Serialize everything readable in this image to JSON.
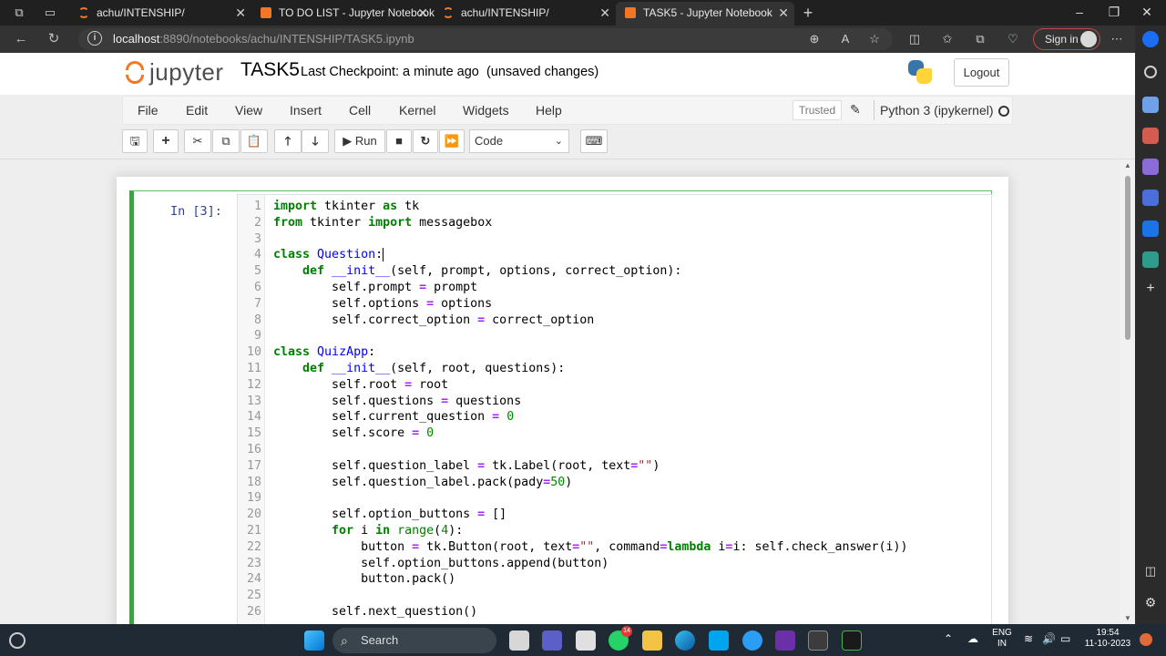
{
  "browser": {
    "tabs": [
      {
        "title": "achu/INTENSHIP/",
        "active": false
      },
      {
        "title": "TO DO LIST - Jupyter Notebook",
        "active": false
      },
      {
        "title": "achu/INTENSHIP/",
        "active": false
      },
      {
        "title": "TASK5 - Jupyter Notebook",
        "active": true
      }
    ],
    "url_host": "localhost",
    "url_path": ":8890/notebooks/achu/INTENSHIP/TASK5.ipynb",
    "signin_label": "Sign in"
  },
  "jupyter": {
    "logo_text": "jupyter",
    "notebook_name": "TASK5",
    "checkpoint_text": "Last Checkpoint: a minute ago",
    "unsaved_text": "(unsaved changes)",
    "logout_label": "Logout",
    "menu": [
      "File",
      "Edit",
      "View",
      "Insert",
      "Cell",
      "Kernel",
      "Widgets",
      "Help"
    ],
    "trusted_label": "Trusted",
    "kernel_name": "Python 3 (ipykernel)",
    "toolbar": {
      "run_label": "Run",
      "cell_type": "Code"
    }
  },
  "cell": {
    "prompt": "In [3]:",
    "lines": [
      "import tkinter as tk",
      "from tkinter import messagebox",
      "",
      "class Question:",
      "    def __init__(self, prompt, options, correct_option):",
      "        self.prompt = prompt",
      "        self.options = options",
      "        self.correct_option = correct_option",
      "",
      "class QuizApp:",
      "    def __init__(self, root, questions):",
      "        self.root = root",
      "        self.questions = questions",
      "        self.current_question = 0",
      "        self.score = 0",
      "",
      "        self.question_label = tk.Label(root, text=\"\")",
      "        self.question_label.pack(pady=50)",
      "",
      "        self.option_buttons = []",
      "        for i in range(4):",
      "            button = tk.Button(root, text=\"\", command=lambda i=i: self.check_answer(i))",
      "            self.option_buttons.append(button)",
      "            button.pack()",
      "",
      "        self.next_question()"
    ]
  },
  "taskbar": {
    "search_label": "Search",
    "lang_line1": "ENG",
    "lang_line2": "IN",
    "time": "19:54",
    "date": "11-10-2023",
    "whatsapp_badge": "14"
  },
  "colors": {
    "jupyter_orange": "#f37726",
    "cell_border": "#42a047",
    "prompt_color": "#303f9f"
  }
}
